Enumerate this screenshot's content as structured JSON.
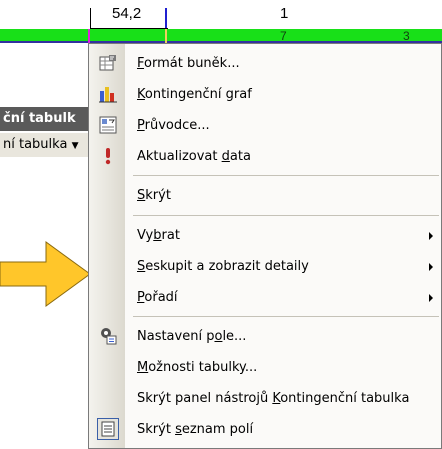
{
  "ruler": {
    "value_left": "54,2",
    "value_right": "1"
  },
  "strip": {
    "num_mid": "7",
    "num_right": "3"
  },
  "pivot_toolbar": {
    "title": "ční tabulk",
    "dropdown_label": "ní tabulka"
  },
  "menu": {
    "items": [
      {
        "icon": "format-cells-icon",
        "pre": "",
        "key": "F",
        "post": "ormát buněk..."
      },
      {
        "icon": "pivot-chart-icon",
        "pre": "",
        "key": "K",
        "post": "ontingenční graf"
      },
      {
        "icon": "wizard-icon",
        "pre": "",
        "key": "P",
        "post": "růvodce..."
      },
      {
        "icon": "refresh-data-icon",
        "pre": "Aktualizovat ",
        "key": "d",
        "post": "ata"
      },
      {
        "icon": "",
        "pre": "",
        "key": "S",
        "post": "krýt"
      },
      {
        "icon": "",
        "pre": "Vy",
        "key": "b",
        "post": "rat"
      },
      {
        "icon": "",
        "pre": "",
        "key": "S",
        "post": "eskupit a zobrazit detaily"
      },
      {
        "icon": "",
        "pre": "",
        "key": "P",
        "post": "ořadí"
      },
      {
        "icon": "field-settings-icon",
        "pre": "Nastavení p",
        "key": "o",
        "post": "le..."
      },
      {
        "icon": "",
        "pre": "",
        "key": "M",
        "post": "ožnosti tabulky..."
      },
      {
        "icon": "",
        "pre": "Skrýt panel nástrojů ",
        "key": "K",
        "post": "ontingenční tabulka"
      },
      {
        "icon": "field-list-icon",
        "pre": "Skrýt ",
        "key": "s",
        "post": "eznam polí"
      }
    ]
  },
  "colors": {
    "strip_green": "#18e018",
    "arrow_yellow": "#ffc62a",
    "menu_bg": "#fbfaf8"
  }
}
